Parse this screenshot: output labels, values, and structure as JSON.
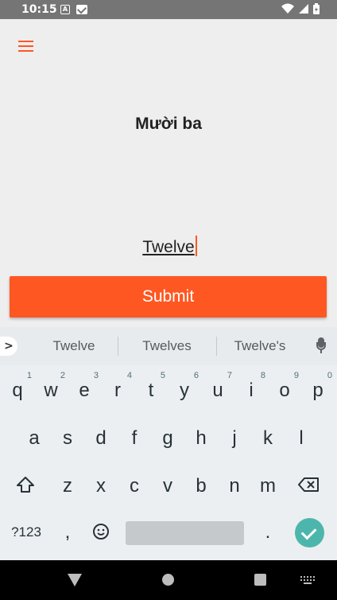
{
  "status_bar": {
    "time": "10:15"
  },
  "app": {
    "prompt": "Mười ba",
    "answer_value": "Twelve",
    "submit_label": "Submit",
    "accent_color": "#ff5722"
  },
  "keyboard": {
    "suggestions": [
      "Twelve",
      "Twelves",
      "Twelve's"
    ],
    "row1": [
      {
        "key": "q",
        "hint": "1"
      },
      {
        "key": "w",
        "hint": "2"
      },
      {
        "key": "e",
        "hint": "3"
      },
      {
        "key": "r",
        "hint": "4"
      },
      {
        "key": "t",
        "hint": "5"
      },
      {
        "key": "y",
        "hint": "6"
      },
      {
        "key": "u",
        "hint": "7"
      },
      {
        "key": "i",
        "hint": "8"
      },
      {
        "key": "o",
        "hint": "9"
      },
      {
        "key": "p",
        "hint": "0"
      }
    ],
    "row2": [
      "a",
      "s",
      "d",
      "f",
      "g",
      "h",
      "j",
      "k",
      "l"
    ],
    "row3": [
      "z",
      "x",
      "c",
      "v",
      "b",
      "n",
      "m"
    ],
    "symbols_label": "?123",
    "comma": ",",
    "period": "."
  }
}
